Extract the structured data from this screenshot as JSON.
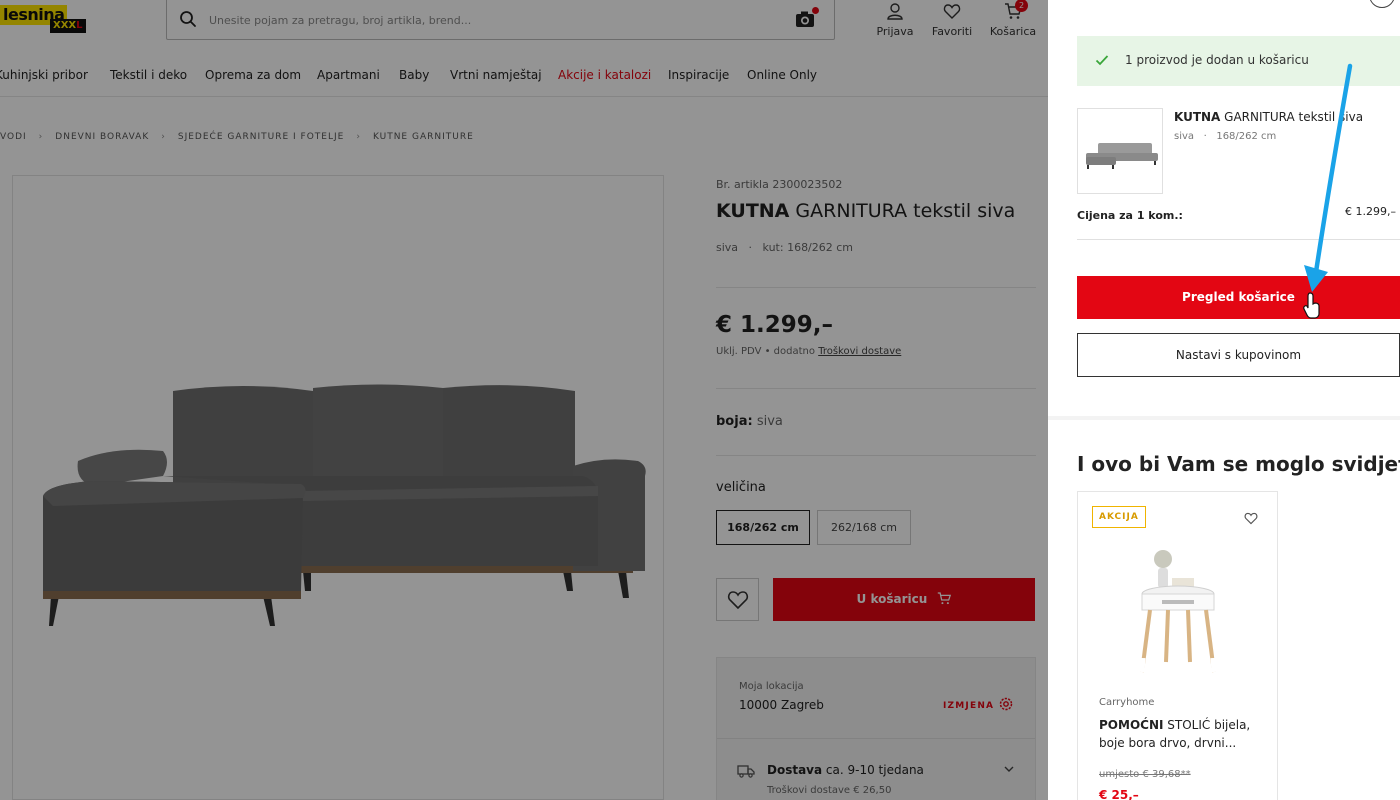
{
  "header": {
    "logo": {
      "word": "lesnina",
      "xxx": "XXX",
      "l": "L"
    },
    "search": {
      "placeholder": "Unesite pojam za pretragu, broj artikla, brend..."
    },
    "login_label": "Prijava",
    "favorites_label": "Favoriti",
    "cart_label": "Košarica",
    "cart_count": "2"
  },
  "nav": {
    "items": [
      {
        "label": "Kuhinjski pribor"
      },
      {
        "label": "Tekstil i deko"
      },
      {
        "label": "Oprema za dom"
      },
      {
        "label": "Apartmani"
      },
      {
        "label": "Baby"
      },
      {
        "label": "Vrtni namještaj"
      },
      {
        "label": "Akcije i katalozi"
      },
      {
        "label": "Inspiracije"
      },
      {
        "label": "Online Only"
      }
    ]
  },
  "breadcrumb": [
    "VODI",
    "DNEVNI BORAVAK",
    "SJEDEĆE GARNITURE I FOTELJE",
    "KUTNE GARNITURE"
  ],
  "product": {
    "article_no": "Br. artikla 2300023502",
    "title_bold": "KUTNA",
    "title_rest": " GARNITURA tekstil siva",
    "color_short": "siva",
    "meta_dot": "·",
    "dimensions": "kut: 168/262 cm",
    "price": "€ 1.299,–",
    "vat_text": "Uklj. PDV • dodatno",
    "shipping_link": "Troškovi dostave",
    "color_label": "boja:",
    "color_value": "siva",
    "size_label": "veličina",
    "sizes": [
      "168/262 cm",
      "262/168 cm"
    ],
    "selected_size": "168/262 cm",
    "add_to_cart": "U košaricu",
    "location_label": "Moja lokacija",
    "location_value": "10000 Zagreb",
    "location_change": "IZMJENA",
    "delivery_bold": "Dostava",
    "delivery_rest": " ca. 9-10 tjedana",
    "delivery_cost": "Troškovi dostave € 26,50"
  },
  "panel": {
    "success_message": "1 proizvod je dodan u košaricu",
    "item_title_bold": "KUTNA",
    "item_title_rest": " GARNITURA tekstil siva",
    "item_color": "siva",
    "item_dot": "·",
    "item_size": "168/262 cm",
    "unit_label": "Cijena za 1 kom.:",
    "unit_price": "€ 1.299,–",
    "view_cart": "Pregled košarice",
    "continue_shopping": "Nastavi s kupovinom",
    "recommendations_title": "I ovo bi Vam se moglo svidjeti",
    "rec": {
      "badge": "AKCIJA",
      "brand": "Carryhome",
      "name_bold": "POMOĆNI",
      "name_rest": " STOLIĆ bijela, boje bora drvo, drvni...",
      "old_price": "umjesto € 39,68**",
      "new_price": "€ 25,–"
    }
  },
  "colors": {
    "accent_red": "#e30613",
    "success_bg": "#e7f5e6",
    "success_check": "#3aa63a",
    "badge_yellow": "#f0b400",
    "arrow_blue": "#1aa3e8"
  },
  "icons": [
    "search-icon",
    "camera-icon",
    "user-icon",
    "heart-icon",
    "cart-icon",
    "gear-icon",
    "truck-icon",
    "chevron-down-icon",
    "check-icon",
    "close-icon",
    "hand-cursor-icon"
  ]
}
